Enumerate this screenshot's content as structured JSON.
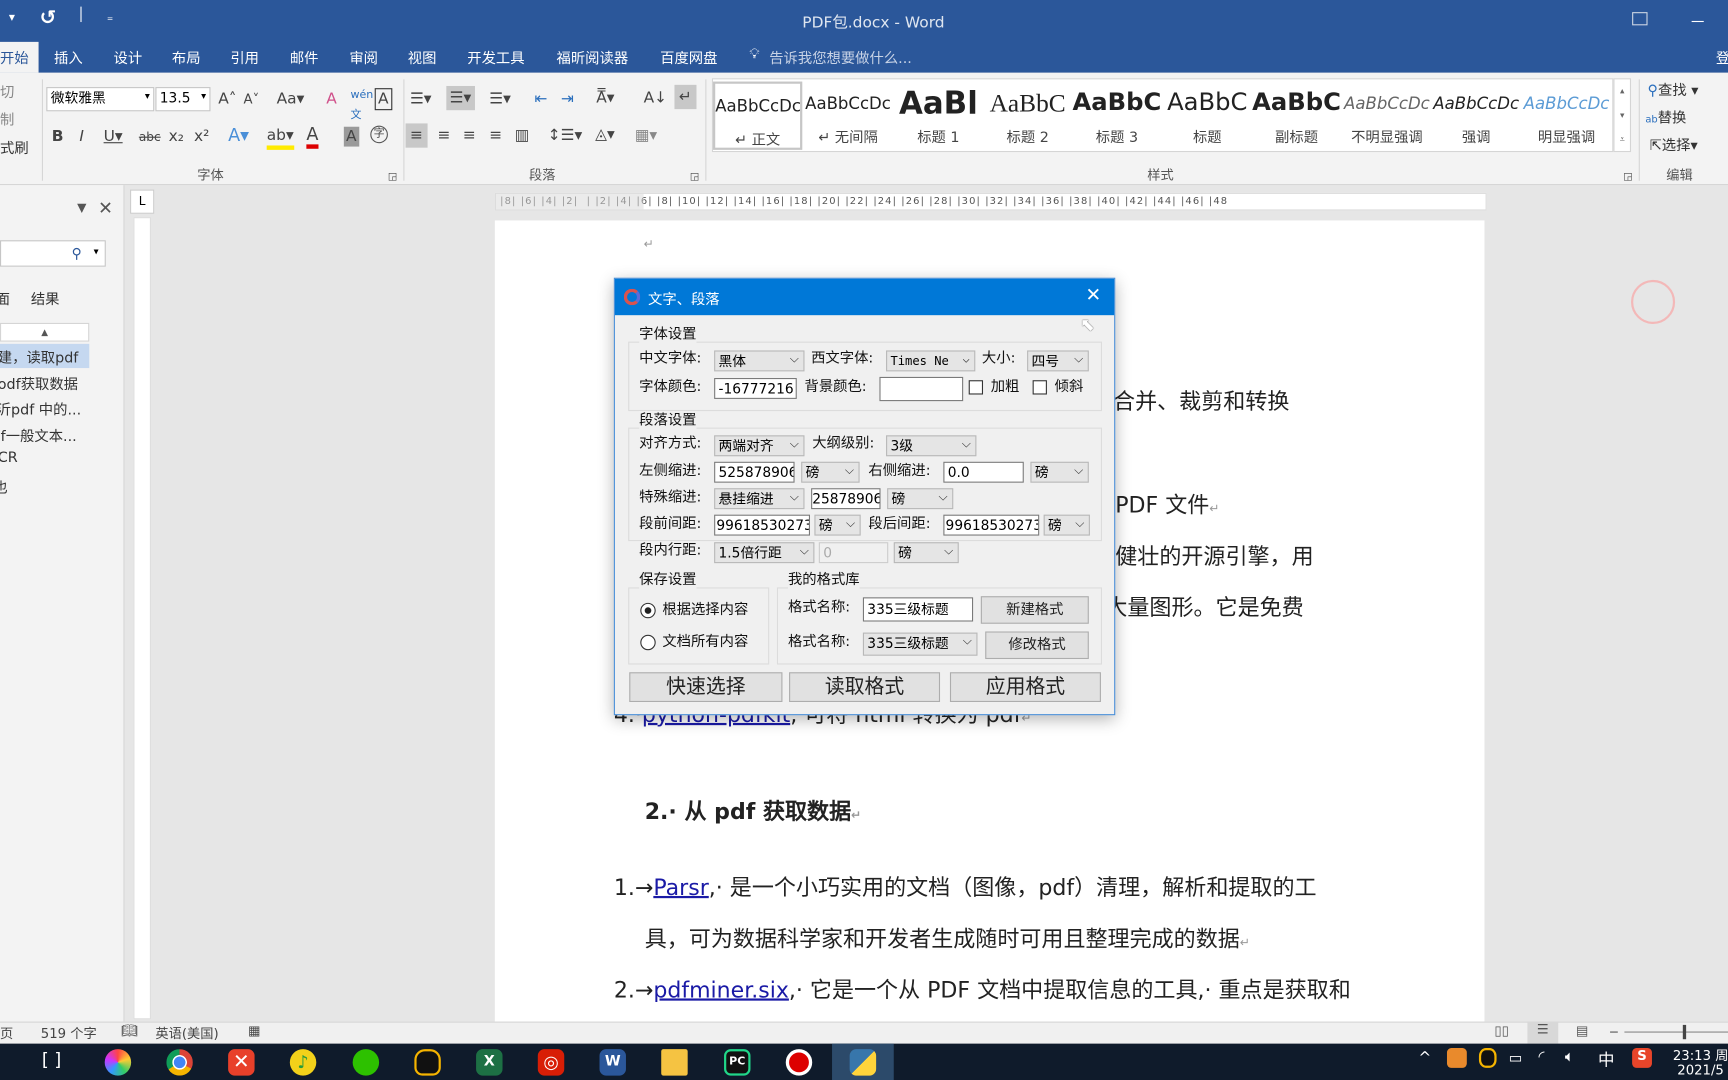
{
  "window": {
    "title": "PDF包.docx - Word",
    "quick_access": [
      "▾",
      "↺",
      "₌"
    ],
    "sign_in": "登"
  },
  "tabs": [
    {
      "label": "开始",
      "active": true
    },
    {
      "label": "插入"
    },
    {
      "label": "设计"
    },
    {
      "label": "布局"
    },
    {
      "label": "引用"
    },
    {
      "label": "邮件"
    },
    {
      "label": "审阅"
    },
    {
      "label": "视图"
    },
    {
      "label": "开发工具"
    },
    {
      "label": "福昕阅读器"
    },
    {
      "label": "百度网盘"
    }
  ],
  "tell_me": "告诉我您想要做什么...",
  "ribbon": {
    "clipboard": {
      "cut": "切",
      "copy": "制",
      "format_painter": "式刷"
    },
    "font": {
      "group": "字体",
      "name": "微软雅黑",
      "size": "13.5"
    },
    "paragraph": {
      "group": "段落"
    },
    "styles": {
      "group": "样式",
      "items": [
        {
          "sample": "AaBbCcDc",
          "name": "↵ 正文",
          "selected": true
        },
        {
          "sample": "AaBbCcDc",
          "name": "↵ 无间隔"
        },
        {
          "sample": "AaBl",
          "name": "标题 1"
        },
        {
          "sample": "AaBbC",
          "name": "标题 2"
        },
        {
          "sample": "AaBbC",
          "name": "标题 3"
        },
        {
          "sample": "AaBbC",
          "name": "标题"
        },
        {
          "sample": "AaBbC",
          "name": "副标题"
        },
        {
          "sample": "AaBbCcDc",
          "name": "不明显强调"
        },
        {
          "sample": "AaBbCcDc",
          "name": "强调"
        },
        {
          "sample": "AaBbCcDc",
          "name": "明显强调"
        }
      ]
    },
    "editing": {
      "group": "编辑",
      "find": "查找",
      "replace": "替换",
      "select": "选择"
    }
  },
  "nav_pane": {
    "tab_pages": "面",
    "tab_results": "结果",
    "items": [
      "建，读取pdf",
      "odf获取数据",
      "沂pdf 中的...",
      "lf一般文本...",
      "CR",
      "也"
    ]
  },
  "document": {
    "mark": "↵",
    "frag1": "合并、裁剪和转换",
    "frag2": "PDF 文件",
    "frag3": "极健壮的开源引擎，用",
    "frag4": "大量图形。它是免费",
    "item4_num": "4.·",
    "item4_link": "python-pdfkit",
    "item4_text": ", 可将 html 转换为 pdf",
    "heading": "2.· 从 pdf 获取数据",
    "p1_num": "1.→",
    "p1_link": "Parsr",
    "p1_text": ",· 是一个小巧实用的文档（图像，pdf）清理，解析和提取的工",
    "p1_cont": "具，可为数据科学家和开发者生成随时可用且整理完成的数据",
    "p2_num": "2.→",
    "p2_link": "pdfminer.six",
    "p2_text": ",· 它是一个从 PDF 文档中提取信息的工具,· 重点是获取和"
  },
  "dialog": {
    "title": "文字、段落",
    "font_group": "字体设置",
    "cn_font_label": "中文字体:",
    "cn_font": "黑体",
    "en_font_label": "西文字体:",
    "en_font": "Times Ne",
    "size_label": "大小:",
    "size": "四号",
    "color_label": "字体颜色:",
    "color": "-16777216",
    "bg_label": "背景颜色:",
    "bg": "",
    "bold": "加粗",
    "bold_checked": false,
    "italic": "倾斜",
    "italic_checked": false,
    "para_group": "段落设置",
    "align_label": "对齐方式:",
    "align": "两端对齐",
    "outline_label": "大纲级别:",
    "outline": "3级",
    "left_label": "左侧缩进:",
    "left": "525878906",
    "left_unit": "磅",
    "right_label": "右侧缩进:",
    "right": "0.0",
    "right_unit": "磅",
    "special_label": "特殊缩进:",
    "special": "悬挂缩进",
    "special_val": "25878906",
    "special_unit": "磅",
    "before_label": "段前间距:",
    "before": "99618530273",
    "before_unit": "磅",
    "after_label": "段后间距:",
    "after": "99618530273",
    "after_unit": "磅",
    "line_label": "段内行距:",
    "line": "1.5倍行距",
    "line_val": "0",
    "line_unit": "磅",
    "save_group": "保存设置",
    "save_sel": "根据选择内容",
    "save_all": "文档所有内容",
    "save_choice": "根据选择内容",
    "lib_group": "我的格式库",
    "fmt_label": "格式名称:",
    "fmt_name": "335三级标题",
    "new_btn": "新建格式",
    "fmt_label2": "格式名称:",
    "fmt_select": "335三级标题",
    "modify_btn": "修改格式",
    "quick_btn": "快速选择",
    "read_btn": "读取格式",
    "apply_btn": "应用格式"
  },
  "status": {
    "page": "页",
    "words": "519 个字",
    "language": "英语(美国)"
  },
  "taskbar": {
    "time": "23:13 周",
    "date": "2021/5",
    "ime": "中"
  },
  "colors": {
    "word_blue": "#2b579a",
    "dialog_title": "#0078d7",
    "taskbar": "#0f1b2b"
  }
}
